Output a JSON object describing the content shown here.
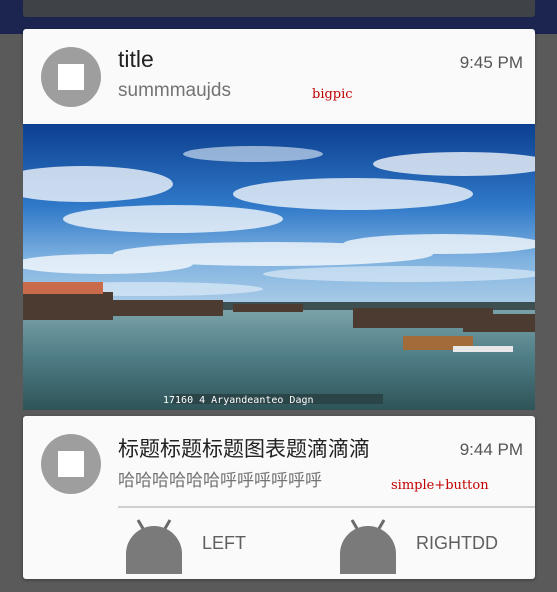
{
  "notifications": [
    {
      "title": "title",
      "text": "summmaujds",
      "time": "9:45 PM",
      "tag": "bigpic",
      "picture_caption": "17160 4 Aryandeanteo Dagn"
    },
    {
      "title": "标题标题标题图表题滴滴滴",
      "text": "哈哈哈哈哈哈呼呼呼呼呼呼",
      "time": "9:44 PM",
      "tag": "simple+button",
      "actions": [
        {
          "label": "LEFT",
          "icon": "android-robot-icon"
        },
        {
          "label": "RIGHTDD",
          "icon": "android-robot-icon"
        }
      ]
    }
  ],
  "colors": {
    "status_bar": "#1c2450",
    "card_background": "#fafafa",
    "tag_text": "#c00000",
    "app_icon": "#9e9e9e"
  }
}
